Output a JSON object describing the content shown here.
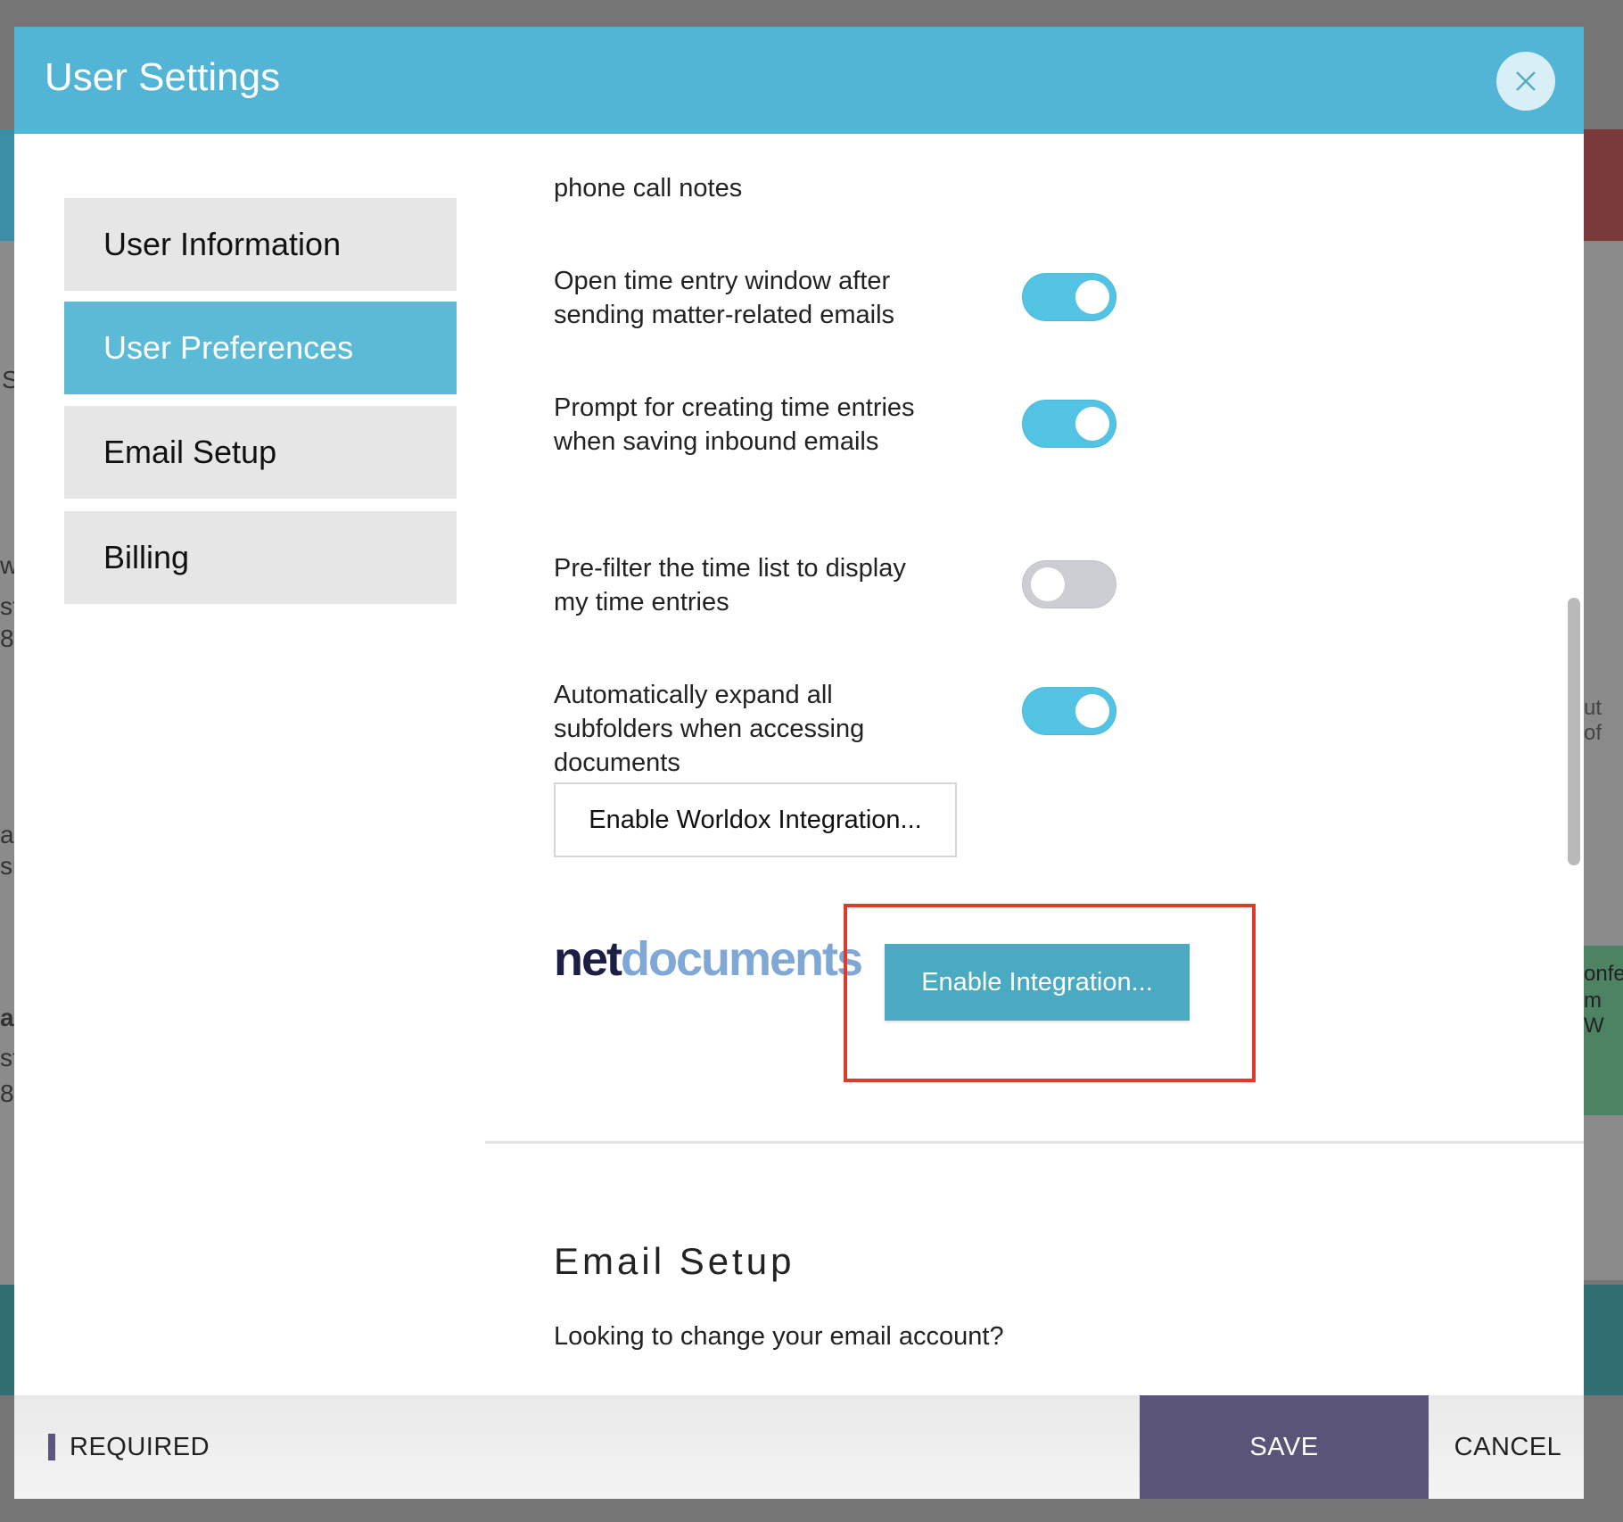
{
  "modal": {
    "title": "User Settings",
    "close_icon": "close-icon"
  },
  "sidebar": {
    "items": [
      {
        "label": "User Information",
        "active": false
      },
      {
        "label": "User Preferences",
        "active": true
      },
      {
        "label": "Email Setup",
        "active": false
      },
      {
        "label": "Billing",
        "active": false
      }
    ]
  },
  "preferences": {
    "partial_text": "phone call notes",
    "items": [
      {
        "label": "Open time entry window after sending matter-related emails",
        "enabled": true
      },
      {
        "label": "Prompt for creating time entries when saving inbound emails",
        "enabled": true
      },
      {
        "label": "Pre-filter the time list to display my time entries",
        "enabled": false
      },
      {
        "label": "Automatically expand all subfolders when accessing documents",
        "enabled": true
      }
    ],
    "worldox_button": "Enable Worldox Integration...",
    "netdocuments": {
      "logo_net": "net",
      "logo_docs": "documents",
      "button": "Enable Integration..."
    }
  },
  "email_setup": {
    "title": "Email Setup",
    "question": "Looking to change your email account?"
  },
  "footer": {
    "required_label": "REQUIRED",
    "save_label": "SAVE",
    "cancel_label": "CANCEL"
  },
  "background": {
    "fragments": [
      "S",
      "w",
      "st",
      "8",
      "a",
      "sl",
      "al",
      "st",
      "8",
      "ut of",
      "onfe",
      "m W"
    ]
  },
  "colors": {
    "header": "#52b5d5",
    "active_nav": "#5bbad5",
    "toggle_on": "#52c3e3",
    "toggle_off": "#ccced3",
    "save": "#5a5578",
    "highlight": "#e03b2a"
  }
}
